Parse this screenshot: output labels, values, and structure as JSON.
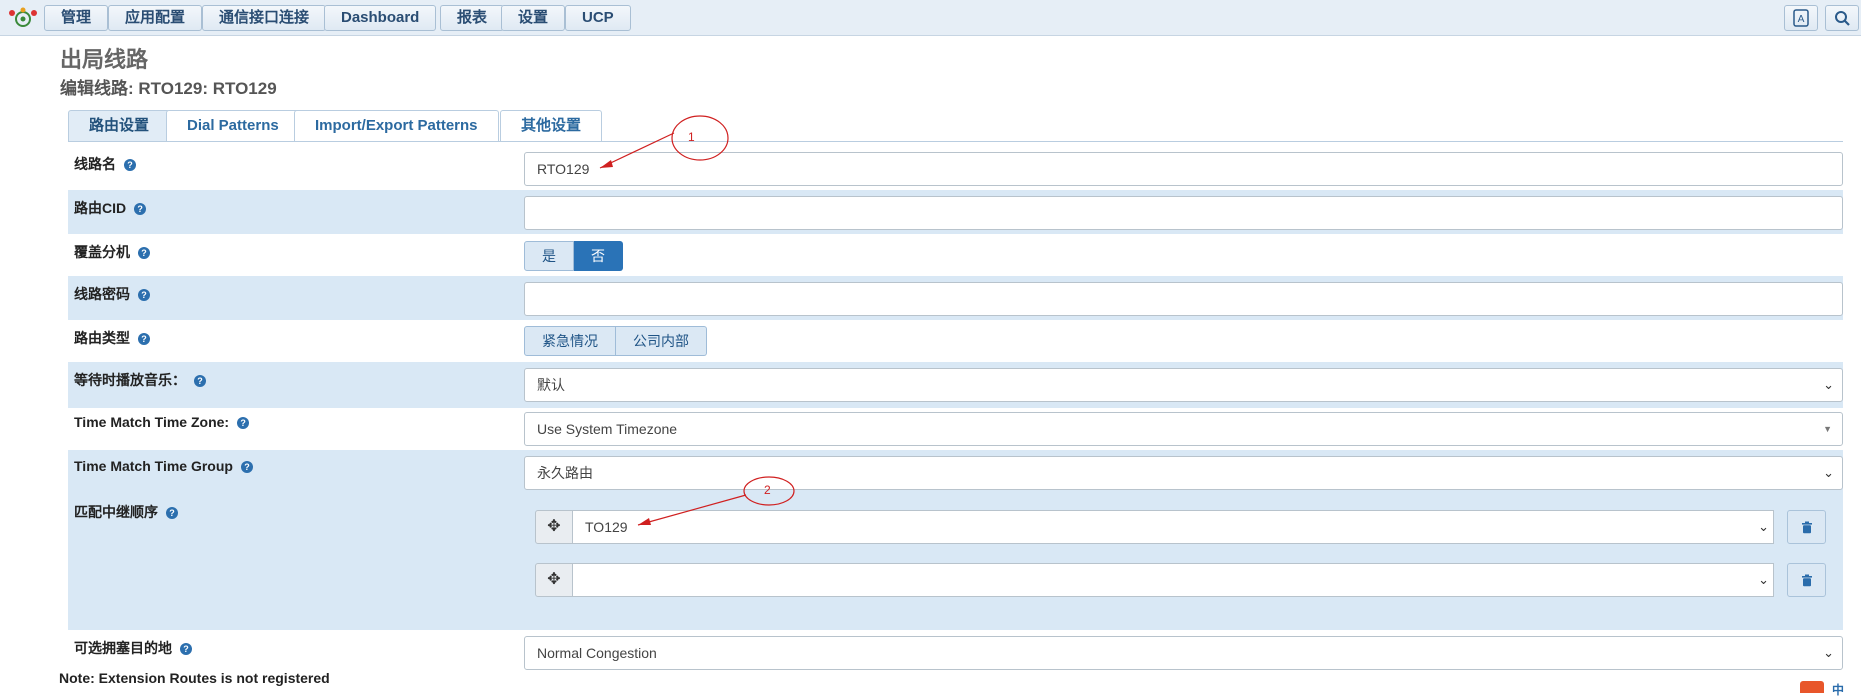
{
  "nav": {
    "items": [
      "管理",
      "应用配置",
      "通信接口连接",
      "Dashboard",
      "报表",
      "设置",
      "UCP"
    ]
  },
  "page": {
    "title": "出局线路",
    "subtitle": "编辑线路: RTO129: RTO129"
  },
  "tabs": [
    "路由设置",
    "Dial Patterns",
    "Import/Export Patterns",
    "其他设置"
  ],
  "form": {
    "route_name": {
      "label": "线路名",
      "value": "RTO129"
    },
    "route_cid": {
      "label": "路由CID",
      "value": ""
    },
    "override_extension": {
      "label": "覆盖分机",
      "options": [
        "是",
        "否"
      ],
      "selected": "否"
    },
    "route_password": {
      "label": "线路密码",
      "value": ""
    },
    "route_type": {
      "label": "路由类型",
      "options": [
        "紧急情况",
        "公司内部"
      ]
    },
    "music_on_hold": {
      "label": "等待时播放音乐：",
      "value": "默认"
    },
    "time_zone": {
      "label": "Time Match Time Zone:",
      "value": "Use System Timezone"
    },
    "time_group": {
      "label": "Time Match Time Group",
      "value": "永久路由"
    },
    "trunk_sequence": {
      "label": "匹配中继顺序",
      "trunks": [
        "TO129",
        ""
      ]
    },
    "congestion_destination": {
      "label": "可选拥塞目的地",
      "value": "Normal Congestion"
    }
  },
  "footer": {
    "note": "Note: Extension Routes is not registered"
  },
  "annotations": [
    "1",
    "2"
  ],
  "colors": {
    "accent": "#2a73b7",
    "row_shade": "#d9e8f5",
    "annotation": "#d02020"
  }
}
